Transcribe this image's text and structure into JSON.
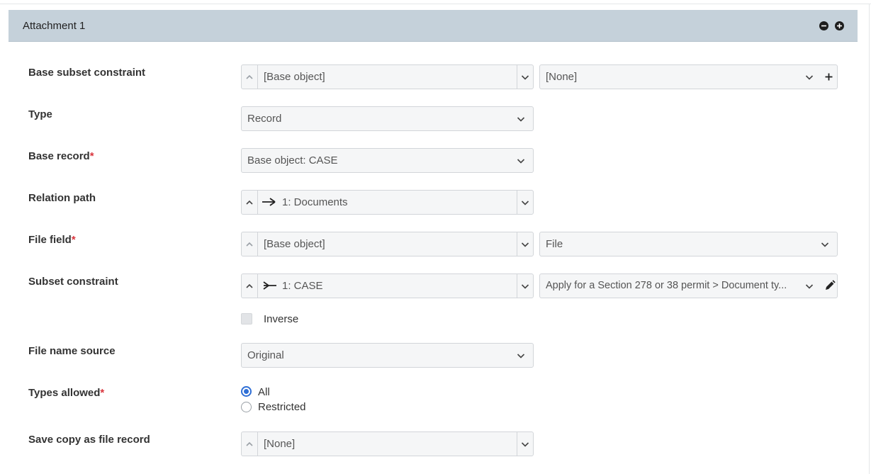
{
  "panel": {
    "title": "Attachment 1",
    "collapse_icon": "minus-circle-icon",
    "expand_icon": "plus-circle-icon"
  },
  "fields": {
    "base_subset_constraint": {
      "label": "Base subset constraint",
      "path_value": "[Base object]",
      "constraint_value": "[None]"
    },
    "type": {
      "label": "Type",
      "value": "Record"
    },
    "base_record": {
      "label": "Base record",
      "required_mark": "*",
      "value": "Base object: CASE"
    },
    "relation_path": {
      "label": "Relation path",
      "value": "1: Documents",
      "icon": "relation-outgoing-icon"
    },
    "file_field": {
      "label": "File field",
      "required_mark": "*",
      "path_value": "[Base object]",
      "field_value": "File"
    },
    "subset_constraint": {
      "label": "Subset constraint",
      "path_value": "1: CASE",
      "icon": "relation-incoming-icon",
      "constraint_value": "Apply for a Section 278 or 38 permit > Document ty...",
      "inverse_label": "Inverse",
      "inverse_checked": false
    },
    "file_name_source": {
      "label": "File name source",
      "value": "Original"
    },
    "types_allowed": {
      "label": "Types allowed",
      "required_mark": "*",
      "options": [
        "All",
        "Restricted"
      ],
      "selected": "All"
    },
    "save_copy": {
      "label": "Save copy as file record",
      "value": "[None]"
    }
  },
  "colors": {
    "header_bg": "#c5d1da",
    "required": "#d9363e",
    "radio_accent": "#2f6fd6"
  }
}
